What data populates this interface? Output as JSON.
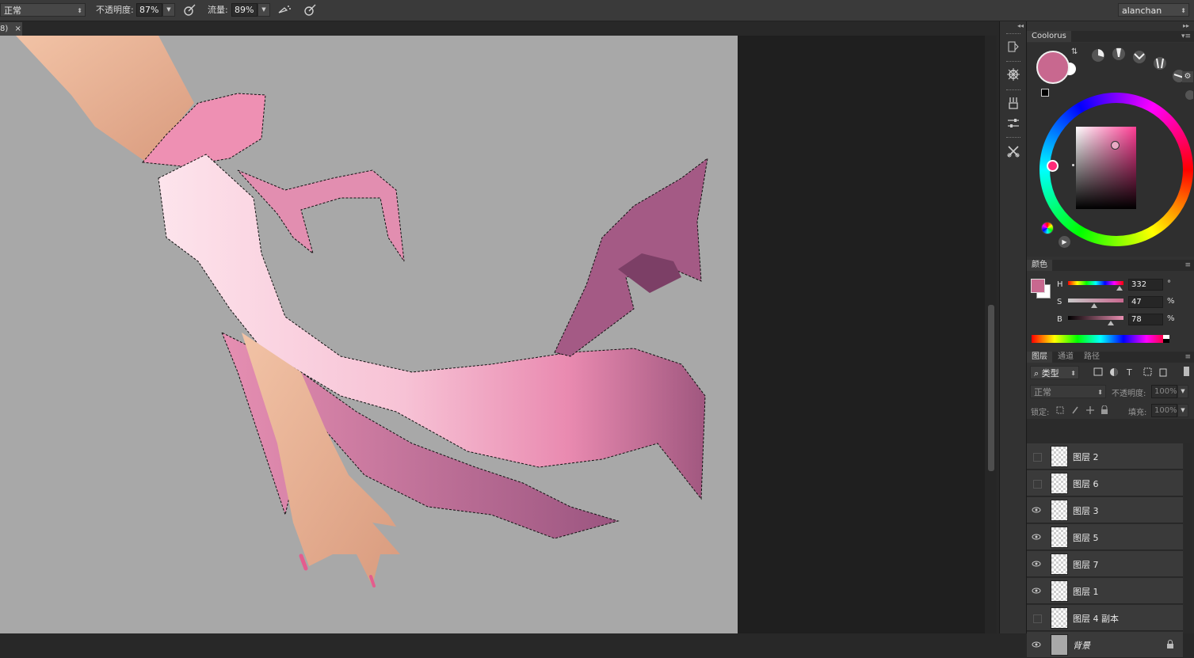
{
  "options_bar": {
    "blend_mode": "正常",
    "opacity_label": "不透明度:",
    "opacity_value": "87%",
    "flow_label": "流量:",
    "flow_value": "89%",
    "workspace": "alanchan"
  },
  "document": {
    "tab_label": "8)",
    "tab_close": "×"
  },
  "coolorus": {
    "title": "Coolorus",
    "foreground_color": "#c8688f",
    "background_color": "#ffffff"
  },
  "color_panel": {
    "title": "颜色",
    "h_label": "H",
    "h_value": "332",
    "h_unit": "°",
    "s_label": "S",
    "s_value": "47",
    "s_unit": "%",
    "b_label": "B",
    "b_value": "78",
    "b_unit": "%"
  },
  "layers_panel": {
    "tabs": [
      "图层",
      "通道",
      "路径"
    ],
    "filter_kind": "类型",
    "blend_mode": "正常",
    "opacity_label": "不透明度:",
    "opacity_value": "100%",
    "lock_label": "锁定:",
    "fill_label": "填充:",
    "fill_value": "100%",
    "layers": [
      {
        "name": "图层 2",
        "visible": false
      },
      {
        "name": "图层 6",
        "visible": false
      },
      {
        "name": "图层 3",
        "visible": true
      },
      {
        "name": "图层 5",
        "visible": true
      },
      {
        "name": "图层 7",
        "visible": true
      },
      {
        "name": "图层 1",
        "visible": true
      },
      {
        "name": "图层 4 副本",
        "visible": false
      },
      {
        "name": "背景",
        "visible": true
      }
    ]
  },
  "colors": {
    "ui_dark": "#323232",
    "canvas_bg": "#a8a8a8",
    "accent_pink": "#c8688f"
  }
}
